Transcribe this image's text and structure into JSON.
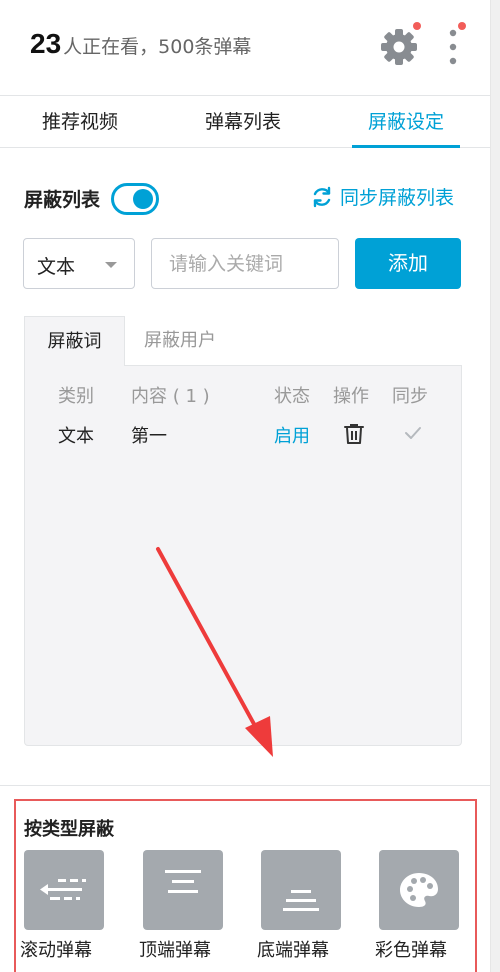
{
  "header": {
    "viewer_count": "23",
    "viewer_text": "人正在看，500条弹幕"
  },
  "tabs": [
    {
      "label": "推荐视频"
    },
    {
      "label": "弹幕列表"
    },
    {
      "label": "屏蔽设定"
    }
  ],
  "block_list": {
    "label": "屏蔽列表",
    "toggle_on": true,
    "sync_label": "同步屏蔽列表"
  },
  "filter": {
    "type_selected": "文本",
    "keyword_placeholder": "请输入关键词",
    "add_label": "添加"
  },
  "subtabs": [
    {
      "label": "屏蔽词"
    },
    {
      "label": "屏蔽用户"
    }
  ],
  "table": {
    "headers": [
      "类别",
      "内容 ( 1 )",
      "状态",
      "操作",
      "同步"
    ],
    "rows": [
      {
        "category": "文本",
        "content": "第一",
        "status": "启用"
      }
    ]
  },
  "type_block": {
    "title": "按类型屏蔽",
    "items": [
      {
        "label": "滚动弹幕",
        "icon": "scroll-danmaku-icon"
      },
      {
        "label": "顶端弹幕",
        "icon": "top-danmaku-icon"
      },
      {
        "label": "底端弹幕",
        "icon": "bottom-danmaku-icon"
      },
      {
        "label": "彩色弹幕",
        "icon": "palette-icon"
      }
    ]
  },
  "colors": {
    "accent": "#00a1d6",
    "icon_tile": "#a4a9ae",
    "annotation_red": "#e85a5a",
    "notification_dot": "#f25d59"
  }
}
